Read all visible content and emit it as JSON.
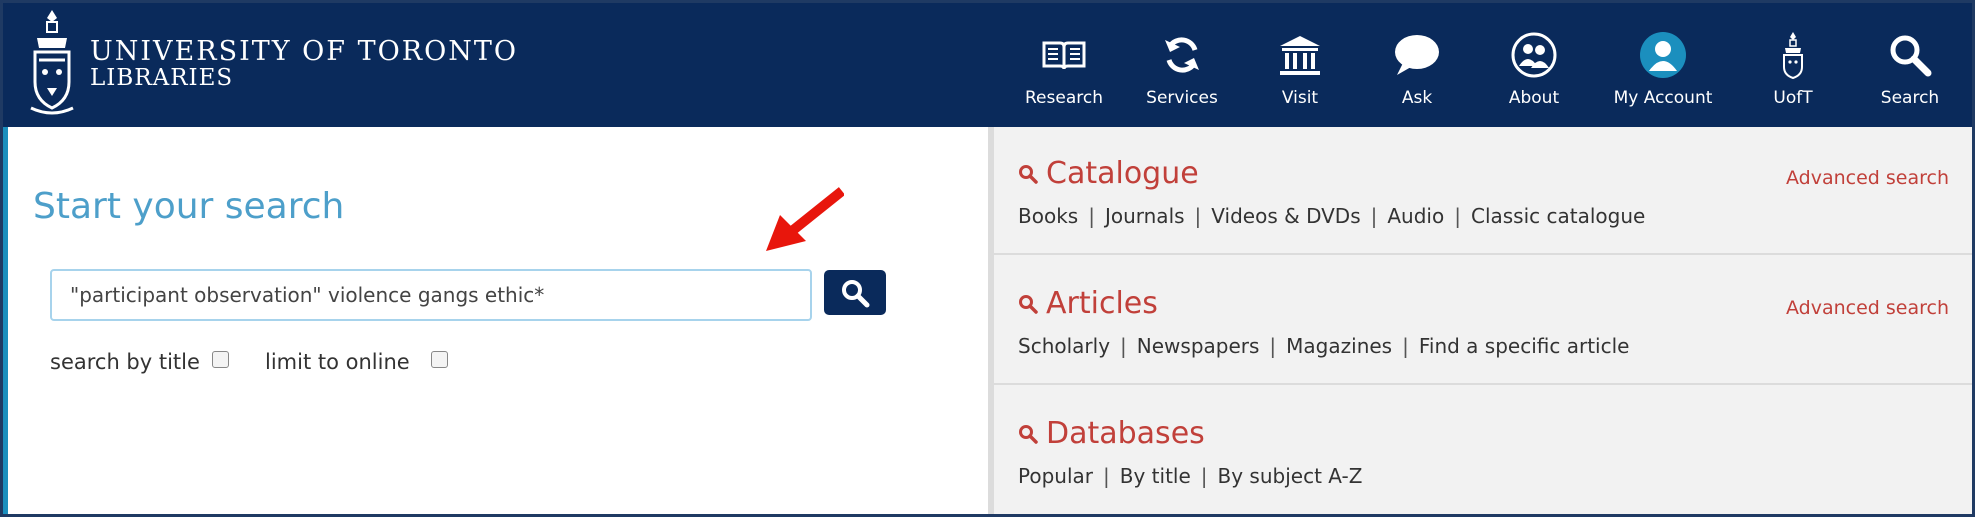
{
  "header": {
    "brand_line1": "UNIVERSITY OF TORONTO",
    "brand_line2": "LIBRARIES",
    "nav": [
      {
        "label": "Research",
        "icon": "book-icon"
      },
      {
        "label": "Services",
        "icon": "refresh-icon"
      },
      {
        "label": "Visit",
        "icon": "building-icon"
      },
      {
        "label": "Ask",
        "icon": "chat-bubble-icon"
      },
      {
        "label": "About",
        "icon": "people-icon"
      },
      {
        "label": "My Account",
        "icon": "user-icon"
      },
      {
        "label": "UofT",
        "icon": "crest-icon"
      },
      {
        "label": "Search",
        "icon": "search-icon"
      }
    ]
  },
  "search": {
    "title": "Start your search",
    "query": "\"participant observation\" violence gangs ethic*",
    "option_title": "search by title",
    "option_online": "limit to online"
  },
  "sections": [
    {
      "title": "Catalogue",
      "advanced": "Advanced search",
      "links": [
        "Books",
        "Journals",
        "Videos & DVDs",
        "Audio",
        "Classic catalogue"
      ]
    },
    {
      "title": "Articles",
      "advanced": "Advanced search",
      "links": [
        "Scholarly",
        "Newspapers",
        "Magazines",
        "Find a specific article"
      ]
    },
    {
      "title": "Databases",
      "advanced": "",
      "links": [
        "Popular",
        "By title",
        "By subject A-Z"
      ]
    }
  ],
  "colors": {
    "header_bg": "#0a2a5b",
    "accent_red": "#c1403a",
    "title_blue": "#4d9fca",
    "annotation_arrow": "#e8160c"
  }
}
